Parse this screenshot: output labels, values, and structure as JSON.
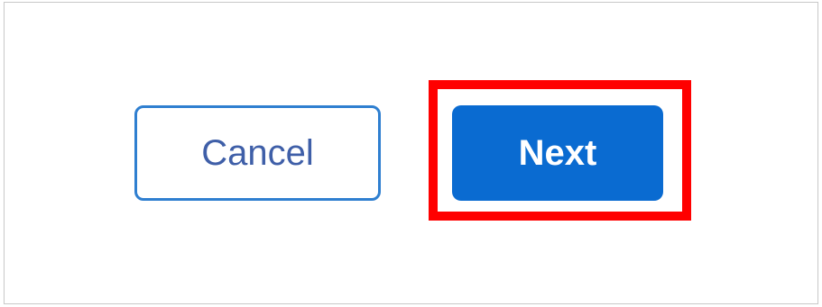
{
  "dialog": {
    "buttons": {
      "cancel_label": "Cancel",
      "next_label": "Next"
    }
  },
  "colors": {
    "primary": "#0a6bd1",
    "secondary_border": "#2f7fd0",
    "highlight": "#ff0000"
  }
}
